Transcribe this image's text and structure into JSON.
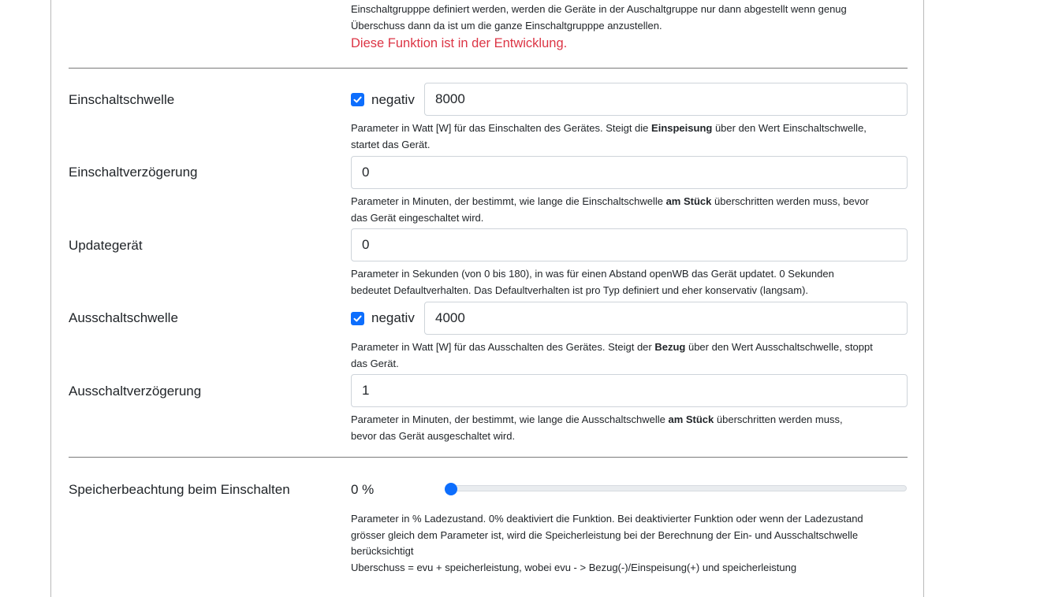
{
  "intro": {
    "line1": "Einschaltgrupppe definiert werden, werden die Geräte in der Auschaltgruppe nur dann abgestellt wenn genug",
    "line2": "Überschuss dann da ist um die ganze Einschaltgrupppe anzustellen.",
    "warning": "Diese Funktion ist in der Entwicklung."
  },
  "fields": {
    "einschaltschwelle": {
      "label": "Einschaltschwelle",
      "negativ_label": "negativ",
      "negativ_checked": true,
      "value": "8000",
      "help1_pre": "Parameter in Watt [W] für das Einschalten des Gerätes. Steigt die ",
      "help1_bold": "Einspeisung",
      "help1_post": " über den Wert Einschaltschwelle,",
      "help2": "startet das Gerät."
    },
    "einschaltverzoegerung": {
      "label": "Einschaltverzögerung",
      "value": "0",
      "help1_pre": "Parameter in Minuten, der bestimmt, wie lange die Einschaltschwelle ",
      "help1_bold": "am Stück",
      "help1_post": " überschritten werden muss, bevor",
      "help2": "das Gerät eingeschaltet wird."
    },
    "updategeraet": {
      "label": "Updategerät",
      "value": "0",
      "help1": "Parameter in Sekunden (von 0 bis 180), in was für einen Abstand openWB das Gerät updatet. 0 Sekunden",
      "help2": "bedeutet Defaultverhalten. Das Defaultverhalten ist pro Typ definiert und eher konservativ (langsam)."
    },
    "ausschaltschwelle": {
      "label": "Ausschaltschwelle",
      "negativ_label": "negativ",
      "negativ_checked": true,
      "value": "4000",
      "help1_pre": "Parameter in Watt [W] für das Ausschalten des Gerätes. Steigt der ",
      "help1_bold": "Bezug",
      "help1_post": " über den Wert Ausschaltschwelle, stoppt",
      "help2": "das Gerät."
    },
    "ausschaltverzoegerung": {
      "label": "Ausschaltverzögerung",
      "value": "1",
      "help1_pre": "Parameter in Minuten, der bestimmt, wie lange die Ausschaltschwelle ",
      "help1_bold": "am Stück",
      "help1_post": " überschritten werden muss,",
      "help2": "bevor das Gerät ausgeschaltet wird."
    },
    "speicherbeachtung": {
      "label": "Speicherbeachtung beim Einschalten",
      "value_text": "0 %",
      "value_percent": 0,
      "help1": "Parameter in % Ladezustand. 0% deaktiviert die Funktion. Bei deaktivierter Funktion oder wenn der Ladezustand",
      "help2": "grösser gleich dem Parameter ist, wird die Speicherleistung bei der Berechnung der Ein- und Ausschaltschwelle",
      "help3": "berücksichtigt",
      "help4": "Uberschuss = evu + speicherleistung, wobei evu - > Bezug(-)/Einspeisung(+) und speicherleistung"
    }
  },
  "colors": {
    "accent": "#0d6efd",
    "warning": "#dc3545",
    "border": "#ced4da",
    "divider": "#7a7a7a"
  }
}
